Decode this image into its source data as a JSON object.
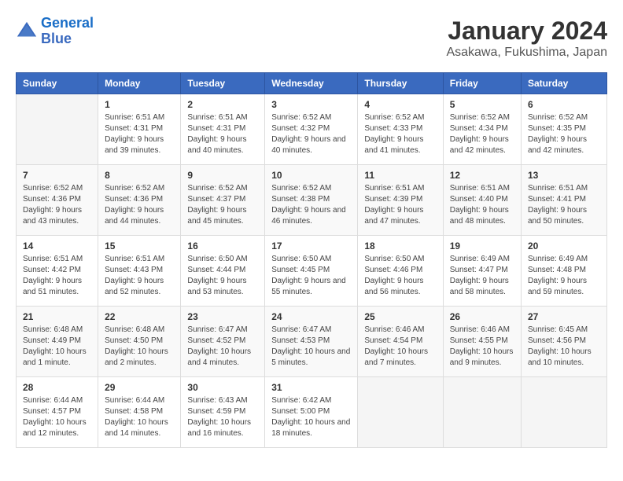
{
  "logo": {
    "line1": "General",
    "line2": "Blue"
  },
  "title": "January 2024",
  "subtitle": "Asakawa, Fukushima, Japan",
  "days_of_week": [
    "Sunday",
    "Monday",
    "Tuesday",
    "Wednesday",
    "Thursday",
    "Friday",
    "Saturday"
  ],
  "weeks": [
    [
      {
        "day": "",
        "sunrise": "",
        "sunset": "",
        "daylight": ""
      },
      {
        "day": "1",
        "sunrise": "Sunrise: 6:51 AM",
        "sunset": "Sunset: 4:31 PM",
        "daylight": "Daylight: 9 hours and 39 minutes."
      },
      {
        "day": "2",
        "sunrise": "Sunrise: 6:51 AM",
        "sunset": "Sunset: 4:31 PM",
        "daylight": "Daylight: 9 hours and 40 minutes."
      },
      {
        "day": "3",
        "sunrise": "Sunrise: 6:52 AM",
        "sunset": "Sunset: 4:32 PM",
        "daylight": "Daylight: 9 hours and 40 minutes."
      },
      {
        "day": "4",
        "sunrise": "Sunrise: 6:52 AM",
        "sunset": "Sunset: 4:33 PM",
        "daylight": "Daylight: 9 hours and 41 minutes."
      },
      {
        "day": "5",
        "sunrise": "Sunrise: 6:52 AM",
        "sunset": "Sunset: 4:34 PM",
        "daylight": "Daylight: 9 hours and 42 minutes."
      },
      {
        "day": "6",
        "sunrise": "Sunrise: 6:52 AM",
        "sunset": "Sunset: 4:35 PM",
        "daylight": "Daylight: 9 hours and 42 minutes."
      }
    ],
    [
      {
        "day": "7",
        "sunrise": "Sunrise: 6:52 AM",
        "sunset": "Sunset: 4:36 PM",
        "daylight": "Daylight: 9 hours and 43 minutes."
      },
      {
        "day": "8",
        "sunrise": "Sunrise: 6:52 AM",
        "sunset": "Sunset: 4:36 PM",
        "daylight": "Daylight: 9 hours and 44 minutes."
      },
      {
        "day": "9",
        "sunrise": "Sunrise: 6:52 AM",
        "sunset": "Sunset: 4:37 PM",
        "daylight": "Daylight: 9 hours and 45 minutes."
      },
      {
        "day": "10",
        "sunrise": "Sunrise: 6:52 AM",
        "sunset": "Sunset: 4:38 PM",
        "daylight": "Daylight: 9 hours and 46 minutes."
      },
      {
        "day": "11",
        "sunrise": "Sunrise: 6:51 AM",
        "sunset": "Sunset: 4:39 PM",
        "daylight": "Daylight: 9 hours and 47 minutes."
      },
      {
        "day": "12",
        "sunrise": "Sunrise: 6:51 AM",
        "sunset": "Sunset: 4:40 PM",
        "daylight": "Daylight: 9 hours and 48 minutes."
      },
      {
        "day": "13",
        "sunrise": "Sunrise: 6:51 AM",
        "sunset": "Sunset: 4:41 PM",
        "daylight": "Daylight: 9 hours and 50 minutes."
      }
    ],
    [
      {
        "day": "14",
        "sunrise": "Sunrise: 6:51 AM",
        "sunset": "Sunset: 4:42 PM",
        "daylight": "Daylight: 9 hours and 51 minutes."
      },
      {
        "day": "15",
        "sunrise": "Sunrise: 6:51 AM",
        "sunset": "Sunset: 4:43 PM",
        "daylight": "Daylight: 9 hours and 52 minutes."
      },
      {
        "day": "16",
        "sunrise": "Sunrise: 6:50 AM",
        "sunset": "Sunset: 4:44 PM",
        "daylight": "Daylight: 9 hours and 53 minutes."
      },
      {
        "day": "17",
        "sunrise": "Sunrise: 6:50 AM",
        "sunset": "Sunset: 4:45 PM",
        "daylight": "Daylight: 9 hours and 55 minutes."
      },
      {
        "day": "18",
        "sunrise": "Sunrise: 6:50 AM",
        "sunset": "Sunset: 4:46 PM",
        "daylight": "Daylight: 9 hours and 56 minutes."
      },
      {
        "day": "19",
        "sunrise": "Sunrise: 6:49 AM",
        "sunset": "Sunset: 4:47 PM",
        "daylight": "Daylight: 9 hours and 58 minutes."
      },
      {
        "day": "20",
        "sunrise": "Sunrise: 6:49 AM",
        "sunset": "Sunset: 4:48 PM",
        "daylight": "Daylight: 9 hours and 59 minutes."
      }
    ],
    [
      {
        "day": "21",
        "sunrise": "Sunrise: 6:48 AM",
        "sunset": "Sunset: 4:49 PM",
        "daylight": "Daylight: 10 hours and 1 minute."
      },
      {
        "day": "22",
        "sunrise": "Sunrise: 6:48 AM",
        "sunset": "Sunset: 4:50 PM",
        "daylight": "Daylight: 10 hours and 2 minutes."
      },
      {
        "day": "23",
        "sunrise": "Sunrise: 6:47 AM",
        "sunset": "Sunset: 4:52 PM",
        "daylight": "Daylight: 10 hours and 4 minutes."
      },
      {
        "day": "24",
        "sunrise": "Sunrise: 6:47 AM",
        "sunset": "Sunset: 4:53 PM",
        "daylight": "Daylight: 10 hours and 5 minutes."
      },
      {
        "day": "25",
        "sunrise": "Sunrise: 6:46 AM",
        "sunset": "Sunset: 4:54 PM",
        "daylight": "Daylight: 10 hours and 7 minutes."
      },
      {
        "day": "26",
        "sunrise": "Sunrise: 6:46 AM",
        "sunset": "Sunset: 4:55 PM",
        "daylight": "Daylight: 10 hours and 9 minutes."
      },
      {
        "day": "27",
        "sunrise": "Sunrise: 6:45 AM",
        "sunset": "Sunset: 4:56 PM",
        "daylight": "Daylight: 10 hours and 10 minutes."
      }
    ],
    [
      {
        "day": "28",
        "sunrise": "Sunrise: 6:44 AM",
        "sunset": "Sunset: 4:57 PM",
        "daylight": "Daylight: 10 hours and 12 minutes."
      },
      {
        "day": "29",
        "sunrise": "Sunrise: 6:44 AM",
        "sunset": "Sunset: 4:58 PM",
        "daylight": "Daylight: 10 hours and 14 minutes."
      },
      {
        "day": "30",
        "sunrise": "Sunrise: 6:43 AM",
        "sunset": "Sunset: 4:59 PM",
        "daylight": "Daylight: 10 hours and 16 minutes."
      },
      {
        "day": "31",
        "sunrise": "Sunrise: 6:42 AM",
        "sunset": "Sunset: 5:00 PM",
        "daylight": "Daylight: 10 hours and 18 minutes."
      },
      {
        "day": "",
        "sunrise": "",
        "sunset": "",
        "daylight": ""
      },
      {
        "day": "",
        "sunrise": "",
        "sunset": "",
        "daylight": ""
      },
      {
        "day": "",
        "sunrise": "",
        "sunset": "",
        "daylight": ""
      }
    ]
  ]
}
